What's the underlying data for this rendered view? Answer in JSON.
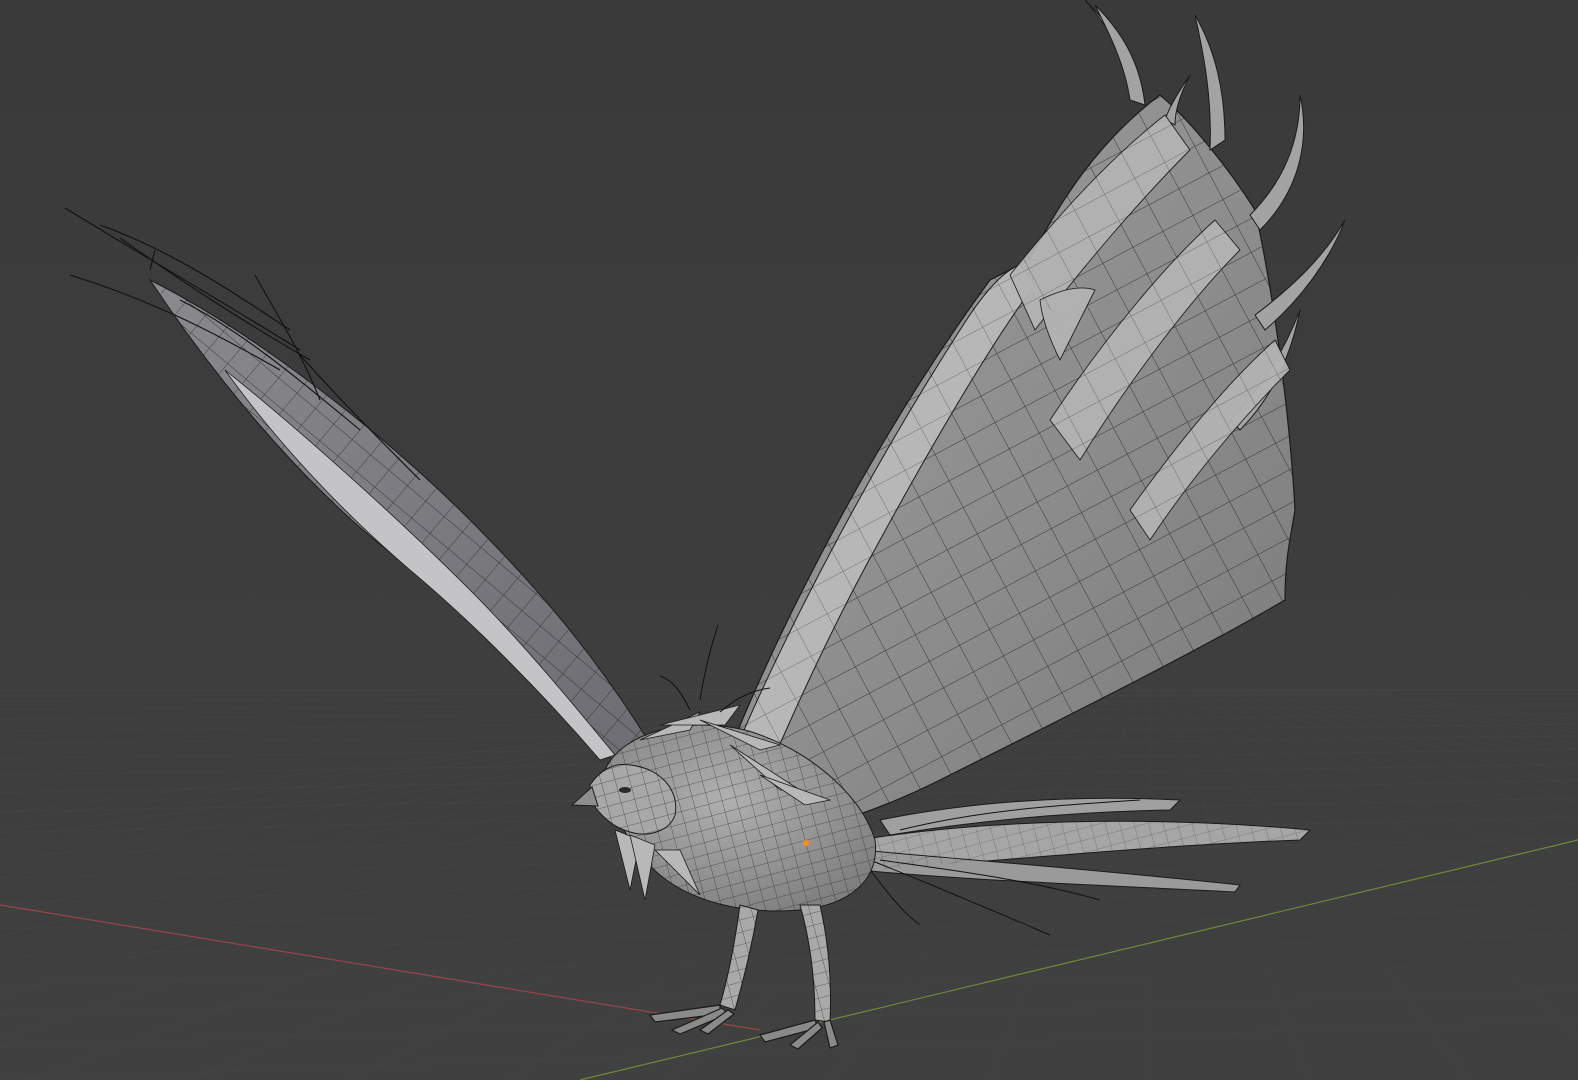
{
  "viewport": {
    "mode": "solid-shading-wireframe-overlay",
    "background_color": "#3d3d3d",
    "grid_color": "#484848",
    "x_axis_color": "#9b4646",
    "y_axis_color": "#6b8a3b",
    "object_origin_color": "#ff8c1a"
  },
  "mesh": {
    "subject": "bird-model",
    "surface_color": "#9a9a9a",
    "wire_color": "#1b1b1b",
    "highlight_color": "#c9c9c9",
    "shadow_color": "#6a6a6a"
  }
}
